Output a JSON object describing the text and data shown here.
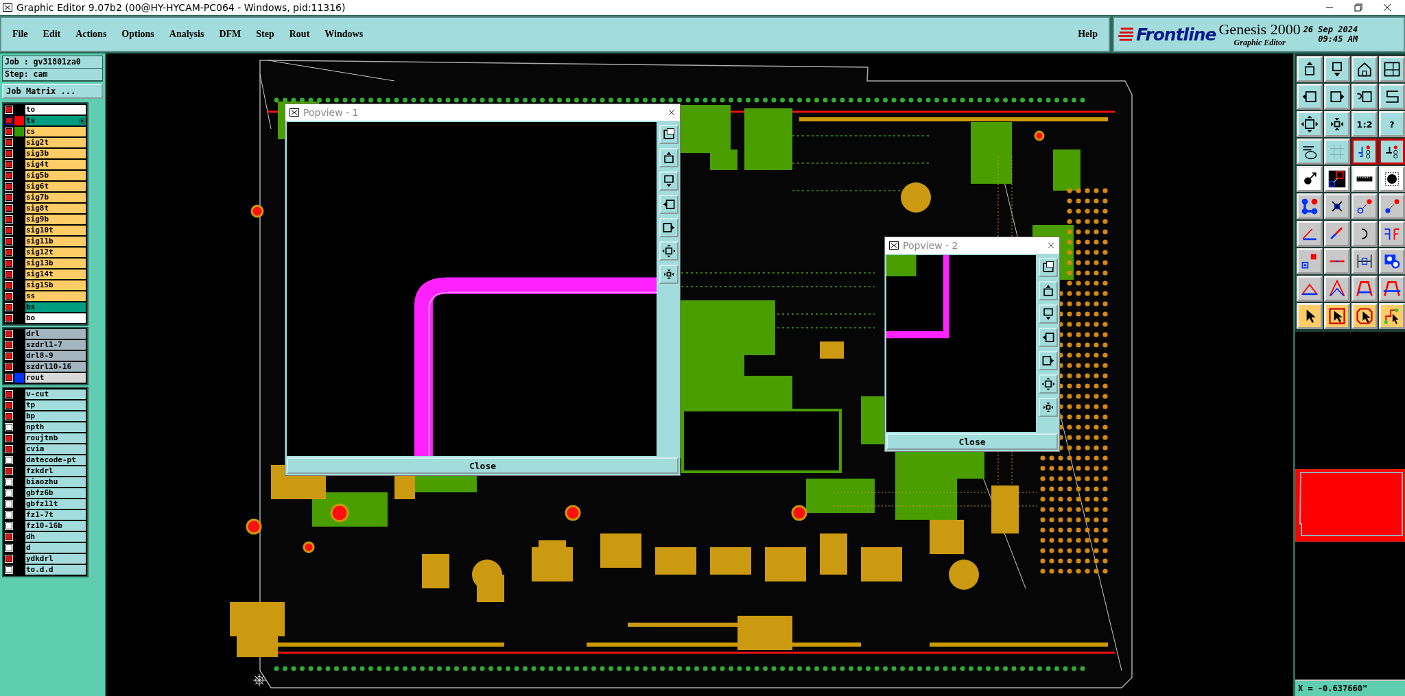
{
  "window": {
    "title": "Graphic Editor 9.07b2 (00@HY-HYCAM-PC064 - Windows, pid:11316)"
  },
  "menu": [
    {
      "label": "File"
    },
    {
      "label": "Edit"
    },
    {
      "label": "Actions"
    },
    {
      "label": "Options"
    },
    {
      "label": "Analysis"
    },
    {
      "label": "DFM"
    },
    {
      "label": "Step"
    },
    {
      "label": "Rout"
    },
    {
      "label": "Windows"
    }
  ],
  "help": "Help",
  "brand": {
    "logo": "Frontline",
    "product": "Genesis 2000",
    "subtitle": "Graphic Editor",
    "date": "26 Sep 2024",
    "time": "09:45 AM"
  },
  "job": {
    "job": "Job : gv31801za0",
    "step": "Step: cam",
    "matrix_button": "Job Matrix ..."
  },
  "layer_groups": [
    {
      "layers": [
        {
          "name": "to",
          "kind": "document",
          "affected": true,
          "selected": false
        },
        {
          "name": "ts",
          "kind": "mask",
          "affected": true,
          "selected": true,
          "color": "#ff0000"
        },
        {
          "name": "cs",
          "kind": "signal",
          "affected": true,
          "selected": false,
          "color": "#339900"
        },
        {
          "name": "sig2t",
          "kind": "signal",
          "affected": true,
          "selected": false
        },
        {
          "name": "sig3b",
          "kind": "signal",
          "affected": true,
          "selected": false
        },
        {
          "name": "sig4t",
          "kind": "signal",
          "affected": true,
          "selected": false
        },
        {
          "name": "sig5b",
          "kind": "signal",
          "affected": true,
          "selected": false
        },
        {
          "name": "sig6t",
          "kind": "signal",
          "affected": true,
          "selected": false
        },
        {
          "name": "sig7b",
          "kind": "signal",
          "affected": true,
          "selected": false
        },
        {
          "name": "sig8t",
          "kind": "signal",
          "affected": true,
          "selected": false
        },
        {
          "name": "sig9b",
          "kind": "signal",
          "affected": true,
          "selected": false
        },
        {
          "name": "sig10t",
          "kind": "signal",
          "affected": true,
          "selected": false
        },
        {
          "name": "sig11b",
          "kind": "signal",
          "affected": true,
          "selected": false
        },
        {
          "name": "sig12t",
          "kind": "signal",
          "affected": true,
          "selected": false
        },
        {
          "name": "sig13b",
          "kind": "signal",
          "affected": true,
          "selected": false
        },
        {
          "name": "sig14t",
          "kind": "signal",
          "affected": true,
          "selected": false
        },
        {
          "name": "sig15b",
          "kind": "signal",
          "affected": true,
          "selected": false
        },
        {
          "name": "ss",
          "kind": "signal",
          "affected": true,
          "selected": false
        },
        {
          "name": "bs",
          "kind": "mask",
          "affected": true,
          "selected": false
        },
        {
          "name": "bo",
          "kind": "document",
          "affected": true,
          "selected": false
        }
      ]
    },
    {
      "layers": [
        {
          "name": "drl",
          "kind": "drill",
          "affected": true,
          "selected": false
        },
        {
          "name": "szdrl1-7",
          "kind": "drill",
          "affected": true,
          "selected": false
        },
        {
          "name": "drl8-9",
          "kind": "drill",
          "affected": true,
          "selected": false
        },
        {
          "name": "szdrl10-16",
          "kind": "drill",
          "affected": true,
          "selected": false
        },
        {
          "name": "rout",
          "kind": "rout",
          "affected": true,
          "selected": false,
          "color": "#0033ff"
        }
      ]
    },
    {
      "layers": [
        {
          "name": "v-cut",
          "kind": "misc",
          "affected": true,
          "selected": false
        },
        {
          "name": "tp",
          "kind": "misc",
          "affected": true,
          "selected": false
        },
        {
          "name": "bp",
          "kind": "misc",
          "affected": true,
          "selected": false
        },
        {
          "name": "npth",
          "kind": "misc",
          "affected": false,
          "selected": false
        },
        {
          "name": "roujtnb",
          "kind": "misc",
          "affected": true,
          "selected": false
        },
        {
          "name": "cvia",
          "kind": "misc",
          "affected": true,
          "selected": false
        },
        {
          "name": "datecode-pt",
          "kind": "misc",
          "affected": false,
          "selected": false
        },
        {
          "name": "fzkdrl",
          "kind": "misc",
          "affected": true,
          "selected": false
        },
        {
          "name": "biaozhu",
          "kind": "misc",
          "affected": false,
          "selected": false
        },
        {
          "name": "gbfz6b",
          "kind": "misc",
          "affected": false,
          "selected": false
        },
        {
          "name": "gbfz11t",
          "kind": "misc",
          "affected": false,
          "selected": false
        },
        {
          "name": "fz1-7t",
          "kind": "misc",
          "affected": false,
          "selected": false
        },
        {
          "name": "fz10-16b",
          "kind": "misc",
          "affected": false,
          "selected": false
        },
        {
          "name": "dh",
          "kind": "misc",
          "affected": true,
          "selected": false
        },
        {
          "name": "d",
          "kind": "misc",
          "affected": false,
          "selected": false
        },
        {
          "name": "ydkdrl",
          "kind": "misc",
          "affected": true,
          "selected": false
        },
        {
          "name": "to.d.d",
          "kind": "misc",
          "affected": false,
          "selected": false
        }
      ]
    }
  ],
  "popviews": [
    {
      "title": "Popview - 1",
      "close": "Close"
    },
    {
      "title": "Popview - 2",
      "close": "Close"
    }
  ],
  "toolbar": [
    {
      "kind": "view",
      "on": false
    },
    {
      "kind": "view",
      "on": false
    },
    {
      "kind": "view",
      "on": false
    },
    {
      "kind": "view",
      "on": false
    },
    {
      "kind": "view",
      "on": false
    },
    {
      "kind": "view",
      "on": false
    },
    {
      "kind": "view",
      "on": false
    },
    {
      "kind": "view",
      "on": false
    },
    {
      "kind": "view",
      "on": false
    },
    {
      "kind": "view",
      "on": false
    },
    {
      "kind": "view",
      "on": false,
      "label": "1:2"
    },
    {
      "kind": "view",
      "on": false,
      "label": "?"
    },
    {
      "kind": "view",
      "on": false
    },
    {
      "kind": "view",
      "on": false
    },
    {
      "kind": "view",
      "on": true
    },
    {
      "kind": "view",
      "on": true
    },
    {
      "kind": "snap",
      "on": false
    },
    {
      "kind": "snap",
      "on": false
    },
    {
      "kind": "snap",
      "on": false
    },
    {
      "kind": "snap",
      "on": false
    },
    {
      "kind": "edit",
      "on": false
    },
    {
      "kind": "edit",
      "on": false
    },
    {
      "kind": "edit",
      "on": false
    },
    {
      "kind": "edit",
      "on": false
    },
    {
      "kind": "edit",
      "on": false
    },
    {
      "kind": "edit",
      "on": false
    },
    {
      "kind": "edit",
      "on": false
    },
    {
      "kind": "edit",
      "on": false
    },
    {
      "kind": "edit",
      "on": false
    },
    {
      "kind": "edit",
      "on": false
    },
    {
      "kind": "edit",
      "on": false
    },
    {
      "kind": "edit",
      "on": false
    },
    {
      "kind": "edit",
      "on": false
    },
    {
      "kind": "edit",
      "on": false
    },
    {
      "kind": "edit",
      "on": false
    },
    {
      "kind": "edit",
      "on": false
    },
    {
      "kind": "select",
      "on": false
    },
    {
      "kind": "select",
      "on": false
    },
    {
      "kind": "select",
      "on": false
    },
    {
      "kind": "select",
      "on": false
    }
  ],
  "status": "X = -0.637660\""
}
